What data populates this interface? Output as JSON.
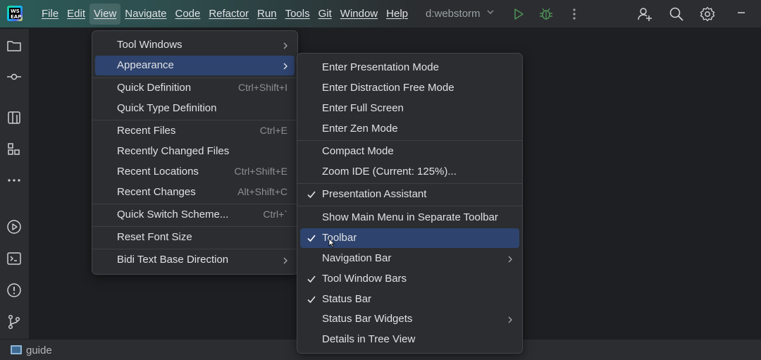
{
  "menubar": {
    "items": [
      "File",
      "Edit",
      "View",
      "Navigate",
      "Code",
      "Refactor",
      "Run",
      "Tools",
      "Git",
      "Window",
      "Help"
    ],
    "active": "View"
  },
  "logo_text": "WS\nEAP",
  "project": {
    "name": "d:webstorm"
  },
  "view_menu": {
    "items": [
      {
        "label": "Tool Windows",
        "submenu": true
      },
      {
        "label": "Appearance",
        "submenu": true,
        "selected": true
      },
      {
        "label": "Quick Definition",
        "shortcut": "Ctrl+Shift+I"
      },
      {
        "label": "Quick Type Definition"
      },
      {
        "label": "Recent Files",
        "shortcut": "Ctrl+E"
      },
      {
        "label": "Recently Changed Files"
      },
      {
        "label": "Recent Locations",
        "shortcut": "Ctrl+Shift+E"
      },
      {
        "label": "Recent Changes",
        "shortcut": "Alt+Shift+C"
      },
      {
        "label": "Quick Switch Scheme...",
        "shortcut": "Ctrl+`"
      },
      {
        "label": "Reset Font Size"
      },
      {
        "label": "Bidi Text Base Direction",
        "submenu": true
      }
    ]
  },
  "appearance_menu": {
    "items": [
      {
        "label": "Enter Presentation Mode"
      },
      {
        "label": "Enter Distraction Free Mode"
      },
      {
        "label": "Enter Full Screen"
      },
      {
        "label": "Enter Zen Mode"
      },
      {
        "label": "Compact Mode"
      },
      {
        "label": "Zoom IDE (Current: 125%)..."
      },
      {
        "label": "Presentation Assistant",
        "checked": true
      },
      {
        "label": "Show Main Menu in Separate Toolbar"
      },
      {
        "label": "Toolbar",
        "checked": true,
        "selected": true
      },
      {
        "label": "Navigation Bar",
        "submenu": true
      },
      {
        "label": "Tool Window Bars",
        "checked": true
      },
      {
        "label": "Status Bar",
        "checked": true
      },
      {
        "label": "Status Bar Widgets",
        "submenu": true
      },
      {
        "label": "Details in Tree View"
      }
    ]
  },
  "statusbar": {
    "project": "guide"
  },
  "icons": {
    "toolbar": [
      "add-user-icon",
      "search-icon",
      "gear-icon",
      "minimize-icon",
      "run-icon",
      "debug-icon",
      "more-vertical-icon"
    ],
    "strip": [
      "folder-icon",
      "commit-icon",
      "structure-icon",
      "plugins-icon",
      "more-icon",
      "services-icon",
      "terminal-icon",
      "problems-icon",
      "git-icon"
    ]
  },
  "colors": {
    "accent": "#2e436e",
    "run_green": "#57965c",
    "menu_bg": "#2b2d30"
  }
}
